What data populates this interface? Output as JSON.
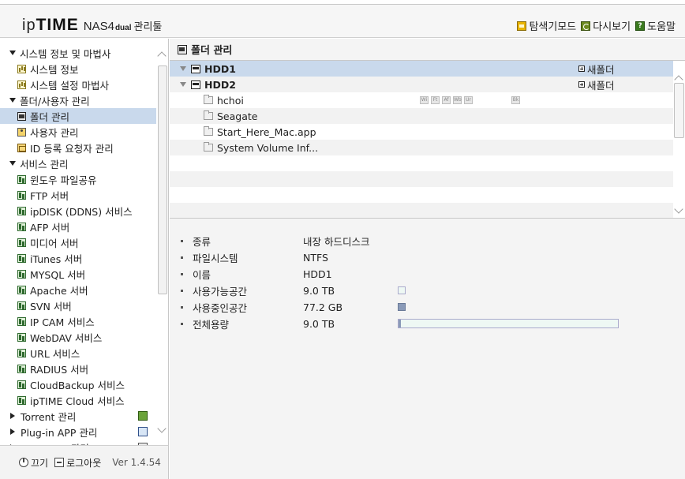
{
  "header": {
    "logo_ip": "ip",
    "logo_time": "TIME",
    "logo_model": "NAS4",
    "logo_dual": "dual",
    "logo_tool": "관리툴",
    "actions": [
      {
        "label": "탐색기모드",
        "icon": "explorer-icon"
      },
      {
        "label": "다시보기",
        "icon": "refresh-icon"
      },
      {
        "label": "도움말",
        "icon": "help-icon"
      }
    ]
  },
  "sidebar": {
    "items": [
      {
        "label": "시스템 정보 및 마법사",
        "type": "group",
        "expanded": true
      },
      {
        "label": "시스템 정보",
        "type": "child",
        "icon": "chart-icon"
      },
      {
        "label": "시스템 설정 마법사",
        "type": "child",
        "icon": "chart-icon"
      },
      {
        "label": "폴더/사용자 관리",
        "type": "group",
        "expanded": true
      },
      {
        "label": "폴더 관리",
        "type": "child",
        "icon": "folder-icon",
        "selected": true
      },
      {
        "label": "사용자 관리",
        "type": "child",
        "icon": "user-icon"
      },
      {
        "label": "ID 등록 요청자 관리",
        "type": "child",
        "icon": "id-icon"
      },
      {
        "label": "서비스 관리",
        "type": "group",
        "expanded": true
      },
      {
        "label": "윈도우 파일공유",
        "type": "child",
        "icon": "service-icon"
      },
      {
        "label": "FTP 서버",
        "type": "child",
        "icon": "service-icon"
      },
      {
        "label": "ipDISK (DDNS) 서비스",
        "type": "child",
        "icon": "service-icon"
      },
      {
        "label": "AFP 서버",
        "type": "child",
        "icon": "service-icon"
      },
      {
        "label": "미디어 서버",
        "type": "child",
        "icon": "service-icon"
      },
      {
        "label": "iTunes 서버",
        "type": "child",
        "icon": "service-icon"
      },
      {
        "label": "MYSQL 서버",
        "type": "child",
        "icon": "service-icon"
      },
      {
        "label": "Apache 서버",
        "type": "child",
        "icon": "service-icon"
      },
      {
        "label": "SVN 서버",
        "type": "child",
        "icon": "service-icon"
      },
      {
        "label": "IP CAM 서비스",
        "type": "child",
        "icon": "service-icon"
      },
      {
        "label": "WebDAV 서비스",
        "type": "child",
        "icon": "service-icon"
      },
      {
        "label": "URL 서비스",
        "type": "child",
        "icon": "service-icon"
      },
      {
        "label": "RADIUS 서버",
        "type": "child",
        "icon": "service-icon"
      },
      {
        "label": "CloudBackup 서비스",
        "type": "child",
        "icon": "service-icon"
      },
      {
        "label": "ipTIME Cloud 서비스",
        "type": "child",
        "icon": "service-icon"
      },
      {
        "label": "Torrent 관리",
        "type": "group",
        "expanded": false,
        "side_icon": "torrent-icon"
      },
      {
        "label": "Plug-in APP 관리",
        "type": "group",
        "expanded": false,
        "side_icon": "plugin-icon"
      },
      {
        "label": "NAS Sync 관리",
        "type": "group",
        "expanded": false,
        "side_icon": "sync-icon"
      }
    ]
  },
  "footer": {
    "power_label": "끄기",
    "logout_label": "로그아웃",
    "version": "Ver 1.4.54"
  },
  "main": {
    "title": "폴더 관리",
    "tree": [
      {
        "name": "HDD1",
        "kind": "disk",
        "selected": true,
        "new_folder": "새폴더"
      },
      {
        "name": "HDD2",
        "kind": "disk",
        "selected": false,
        "new_folder": "새폴더"
      },
      {
        "name": "hchoi",
        "kind": "folder",
        "flags": [
          "Wi",
          "Ft",
          "Af",
          "Wb",
          "Ur",
          "Bk"
        ]
      },
      {
        "name": "Seagate",
        "kind": "folder"
      },
      {
        "name": "Start_Here_Mac.app",
        "kind": "folder"
      },
      {
        "name": "System Volume Inf...",
        "kind": "folder"
      }
    ],
    "details": [
      {
        "label": "종류",
        "value": "내장 하드디스크"
      },
      {
        "label": "파일시스템",
        "value": "NTFS"
      },
      {
        "label": "이름",
        "value": "HDD1"
      },
      {
        "label": "사용가능공간",
        "value": "9.0 TB",
        "swatch": "free"
      },
      {
        "label": "사용중인공간",
        "value": "77.2 GB",
        "swatch": "used"
      },
      {
        "label": "전체용량",
        "value": "9.0 TB",
        "used_fraction": 0.008
      }
    ]
  },
  "colors": {
    "selected_bg": "#c9d9ec",
    "used": "#8a9ab8",
    "free": "#eef8f4"
  }
}
